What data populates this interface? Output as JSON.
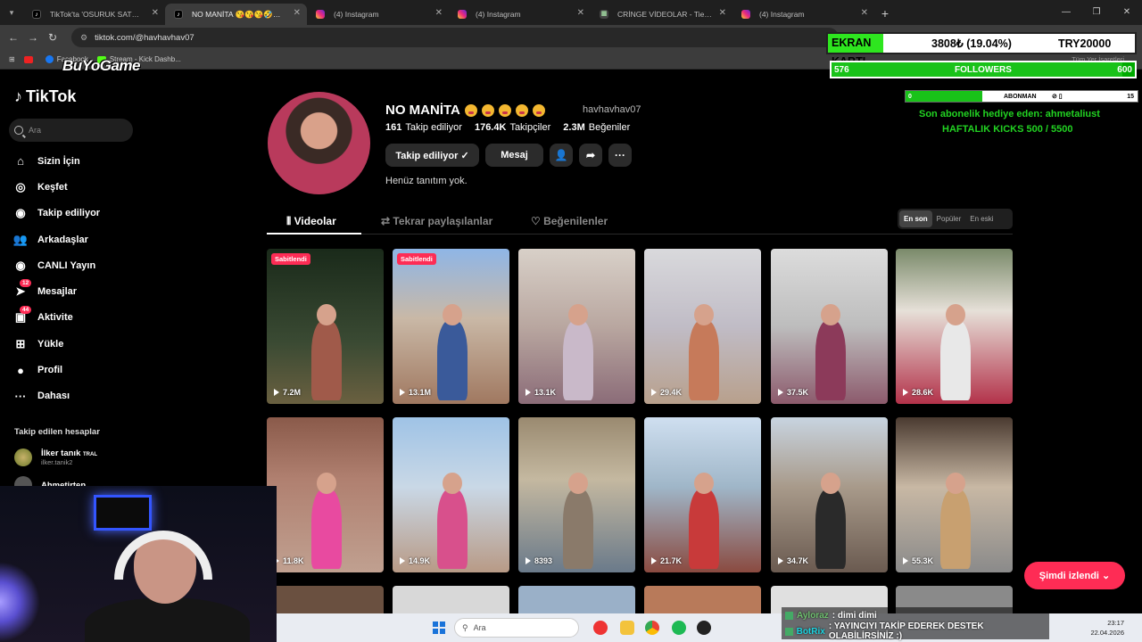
{
  "browser": {
    "tabs": [
      {
        "label": "TikTok'ta 'OSURUK SATMA' bul",
        "icon": "tiktok-icon",
        "active": false
      },
      {
        "label": "NO MANİTA 😘😘😘🤣🤣 (@",
        "icon": "tiktok-icon",
        "active": true
      },
      {
        "label": "(4) Instagram",
        "icon": "instagram-icon",
        "active": false
      },
      {
        "label": "(4) Instagram",
        "icon": "instagram-icon",
        "active": false
      },
      {
        "label": "CRİNGE VİDEOLAR - Tier List, K",
        "icon": "tierlist-icon",
        "active": false
      },
      {
        "label": "(4) Instagram",
        "icon": "instagram-icon",
        "active": false
      }
    ],
    "url": "tiktok.com/@havhavhav07",
    "bookmarks": [
      "Facebook",
      "Stream - Kick Dashb..."
    ],
    "bookmarks_all": "Tüm Yer İşaretleri",
    "window_controls": [
      "—",
      "❐",
      "✕"
    ]
  },
  "tiktok": {
    "logo": "TikTok",
    "search_placeholder": "Ara",
    "nav": [
      {
        "label": "Sizin İçin",
        "icon": "home-icon",
        "glyph": "⌂"
      },
      {
        "label": "Keşfet",
        "icon": "compass-icon",
        "glyph": "◎"
      },
      {
        "label": "Takip ediliyor",
        "icon": "following-icon",
        "glyph": "◉"
      },
      {
        "label": "Arkadaşlar",
        "icon": "friends-icon",
        "glyph": "👥"
      },
      {
        "label": "CANLI Yayın",
        "icon": "live-icon",
        "glyph": "◉"
      },
      {
        "label": "Mesajlar",
        "icon": "messages-icon",
        "glyph": "➤",
        "badge": "12"
      },
      {
        "label": "Aktivite",
        "icon": "activity-icon",
        "glyph": "▣",
        "badge": "44"
      },
      {
        "label": "Yükle",
        "icon": "upload-icon",
        "glyph": "⊞"
      },
      {
        "label": "Profil",
        "icon": "profile-avatar-icon",
        "glyph": "●"
      },
      {
        "label": "Dahası",
        "icon": "more-icon",
        "glyph": "···"
      }
    ],
    "following_header": "Takip edilen hesaplar",
    "following_accounts": [
      {
        "name": "İlker tanık",
        "tag": "TRAL",
        "sub": "ilker.tanik2"
      },
      {
        "name": "Ahmetirten",
        "tag": "",
        "sub": ""
      }
    ]
  },
  "profile": {
    "name": "NO MANİTA",
    "emoji_count": 5,
    "handle": "havhavhav07",
    "stats": [
      {
        "value": "161",
        "label": "Takip ediliyor"
      },
      {
        "value": "176.4K",
        "label": "Takipçiler"
      },
      {
        "value": "2.3M",
        "label": "Beğeniler"
      }
    ],
    "follow_button": "Takip ediliyor ✓",
    "message_button": "Mesaj",
    "bio": "Henüz tanıtım yok.",
    "tabs": [
      "Videolar",
      "Tekrar paylaşılanlar",
      "Beğenilenler"
    ],
    "sort_options": [
      "En son",
      "Popüler",
      "En eski"
    ],
    "sort_selected": "En son",
    "pinned_label": "Sabitlendi",
    "videos": [
      {
        "views": "7.2M",
        "pinned": true,
        "scene": "night"
      },
      {
        "views": "13.1M",
        "pinned": true,
        "scene": "yard"
      },
      {
        "views": "13.1K",
        "pinned": false,
        "scene": "indoor"
      },
      {
        "views": "29.4K",
        "pinned": false,
        "scene": "hospital"
      },
      {
        "views": "37.5K",
        "pinned": false,
        "scene": "hospital2"
      },
      {
        "views": "28.6K",
        "pinned": false,
        "scene": "selfie"
      },
      {
        "views": "11.8K",
        "pinned": false,
        "scene": "wall"
      },
      {
        "views": "14.9K",
        "pinned": false,
        "scene": "sky"
      },
      {
        "views": "8393",
        "pinned": false,
        "scene": "picnic"
      },
      {
        "views": "21.7K",
        "pinned": false,
        "scene": "sky2"
      },
      {
        "views": "34.7K",
        "pinned": false,
        "scene": "roof"
      },
      {
        "views": "55.3K",
        "pinned": false,
        "scene": "kitchen"
      }
    ],
    "watched_button": "Şimdi izlendi ⌄"
  },
  "overlay": {
    "logo": "BuYoGame",
    "card_label": "EKRAN KARTI",
    "card_amount": "3808₺ (19.04%)",
    "card_goal": "TRY20000",
    "followers_current": "576",
    "followers_label": "FOLLOWERS",
    "followers_goal": "600",
    "followers_progress": 0.96,
    "sub_current": "0",
    "sub_label": "ABONMAN",
    "sub_goal": "15",
    "sub_progress": 0.33,
    "gift_text": "Son abonelik hediye eden: ahmetaliust",
    "kicks_text": "HAFTALIK KICKS 500 / 5500"
  },
  "chat": [
    {
      "user": "Ayloraz",
      "text": ": dimi dimi"
    },
    {
      "user": "BotRix",
      "text": ": YAYINCIYI TAKİP EDEREK DESTEK OLABİLİRSİNİZ :)"
    }
  ],
  "taskbar": {
    "search_placeholder": "Ara",
    "time": "23:17",
    "date": "22.04.2026"
  }
}
